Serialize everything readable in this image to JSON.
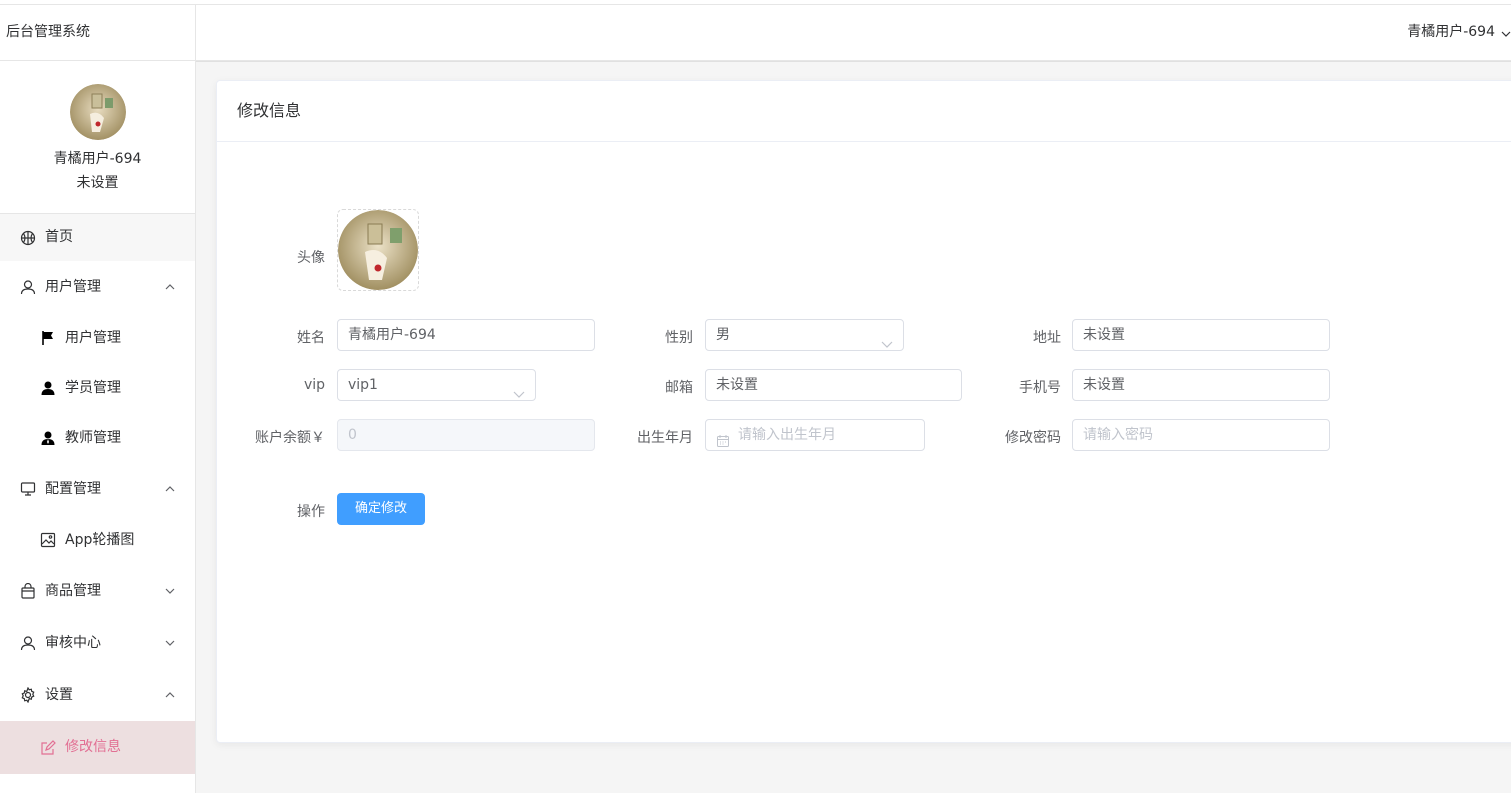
{
  "app": {
    "brand": "后台管理系统"
  },
  "header": {
    "user_name": "青橘用户-694"
  },
  "sidebar": {
    "profile_name": "青橘用户-694",
    "profile_sub": "未设置",
    "menu": {
      "home": "首页",
      "user_mgmt": "用户管理",
      "user_mgmt_sub": "用户管理",
      "student_mgmt": "学员管理",
      "teacher_mgmt": "教师管理",
      "config_mgmt": "配置管理",
      "app_carousel": "App轮播图",
      "goods_mgmt": "商品管理",
      "review_center": "审核中心",
      "settings": "设置",
      "edit_info": "修改信息"
    }
  },
  "card": {
    "title": "修改信息"
  },
  "form": {
    "avatar_label": "头像",
    "name_label": "姓名",
    "name_value": "青橘用户-694",
    "gender_label": "性别",
    "gender_value": "男",
    "address_label": "地址",
    "address_value": "未设置",
    "vip_label": "vip",
    "vip_value": "vip1",
    "email_label": "邮箱",
    "email_value": "未设置",
    "phone_label": "手机号",
    "phone_value": "未设置",
    "balance_label": "账户余额￥",
    "balance_value": "0",
    "birth_label": "出生年月",
    "birth_placeholder": "请输入出生年月",
    "password_label": "修改密码",
    "password_placeholder": "请输入密码",
    "action_label": "操作",
    "submit_label": "确定修改"
  },
  "colors": {
    "primary": "#409eff",
    "active_text": "#e26f93",
    "active_bg": "#eddfe0"
  }
}
